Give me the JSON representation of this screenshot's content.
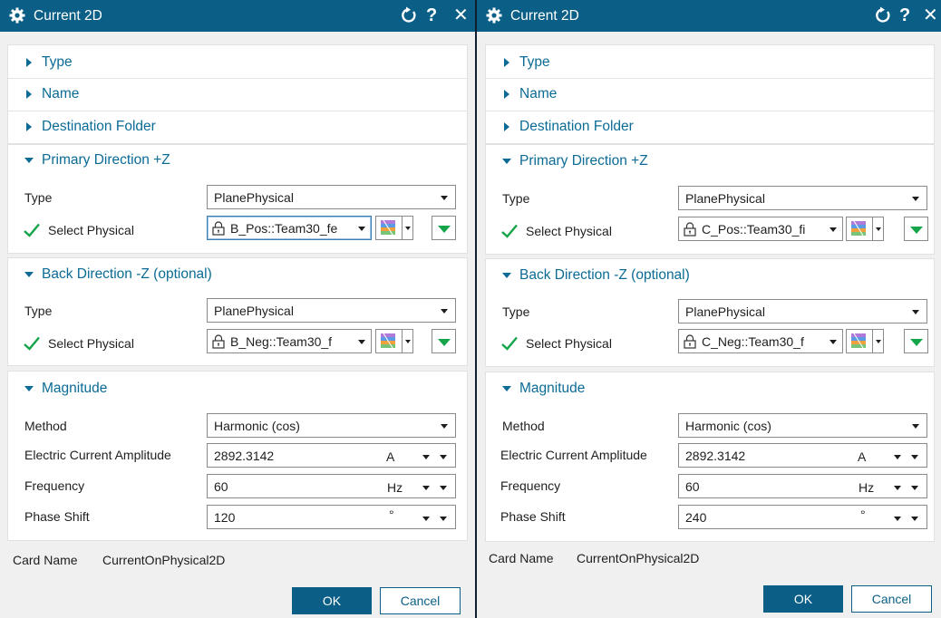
{
  "dialogs": [
    {
      "title": "Current 2D",
      "sections": {
        "type": "Type",
        "name": "Name",
        "dest": "Destination Folder",
        "primary": "Primary Direction +Z",
        "back": "Back Direction -Z (optional)",
        "magnitude": "Magnitude"
      },
      "primary": {
        "type_label": "Type",
        "type_value": "PlanePhysical",
        "select_label": "Select Physical",
        "select_value": "B_Pos::Team30_fe"
      },
      "back": {
        "type_label": "Type",
        "type_value": "PlanePhysical",
        "select_label": "Select Physical",
        "select_value": "B_Neg::Team30_f"
      },
      "magnitude": {
        "method_label": "Method",
        "method_value": "Harmonic (cos)",
        "amp_label": "Electric Current Amplitude",
        "amp_value": "2892.3142",
        "amp_unit": "A",
        "freq_label": "Frequency",
        "freq_value": "60",
        "freq_unit": "Hz",
        "phase_label": "Phase Shift",
        "phase_value": "120",
        "phase_unit": "°"
      },
      "card_label": "Card Name",
      "card_value": "CurrentOnPhysical2D",
      "ok_label": "OK",
      "cancel_label": "Cancel"
    },
    {
      "title": "Current 2D",
      "sections": {
        "type": "Type",
        "name": "Name",
        "dest": "Destination Folder",
        "primary": "Primary Direction +Z",
        "back": "Back Direction -Z (optional)",
        "magnitude": "Magnitude"
      },
      "primary": {
        "type_label": "Type",
        "type_value": "PlanePhysical",
        "select_label": "Select Physical",
        "select_value": "C_Pos::Team30_fi"
      },
      "back": {
        "type_label": "Type",
        "type_value": "PlanePhysical",
        "select_label": "Select Physical",
        "select_value": "C_Neg::Team30_f"
      },
      "magnitude": {
        "method_label": "Method",
        "method_value": "Harmonic (cos)",
        "amp_label": "Electric Current Amplitude",
        "amp_value": "2892.3142",
        "amp_unit": "A",
        "freq_label": "Frequency",
        "freq_value": "60",
        "freq_unit": "Hz",
        "phase_label": "Phase Shift",
        "phase_value": "240",
        "phase_unit": "°"
      },
      "card_label": "Card Name",
      "card_value": "CurrentOnPhysical2D",
      "ok_label": "OK",
      "cancel_label": "Cancel"
    }
  ],
  "icons": {
    "title_gear": "gear-icon",
    "reset": "reset-icon",
    "help": "help-icon",
    "close": "close-icon",
    "lock": "lock-icon",
    "check": "checkmark-icon",
    "selection_filter": "selection-filter-icon"
  },
  "colors": {
    "titlebar": "#0b5f87",
    "section_title": "#0b6b95",
    "check": "#14a44a",
    "ok_button": "#0b5f87"
  }
}
